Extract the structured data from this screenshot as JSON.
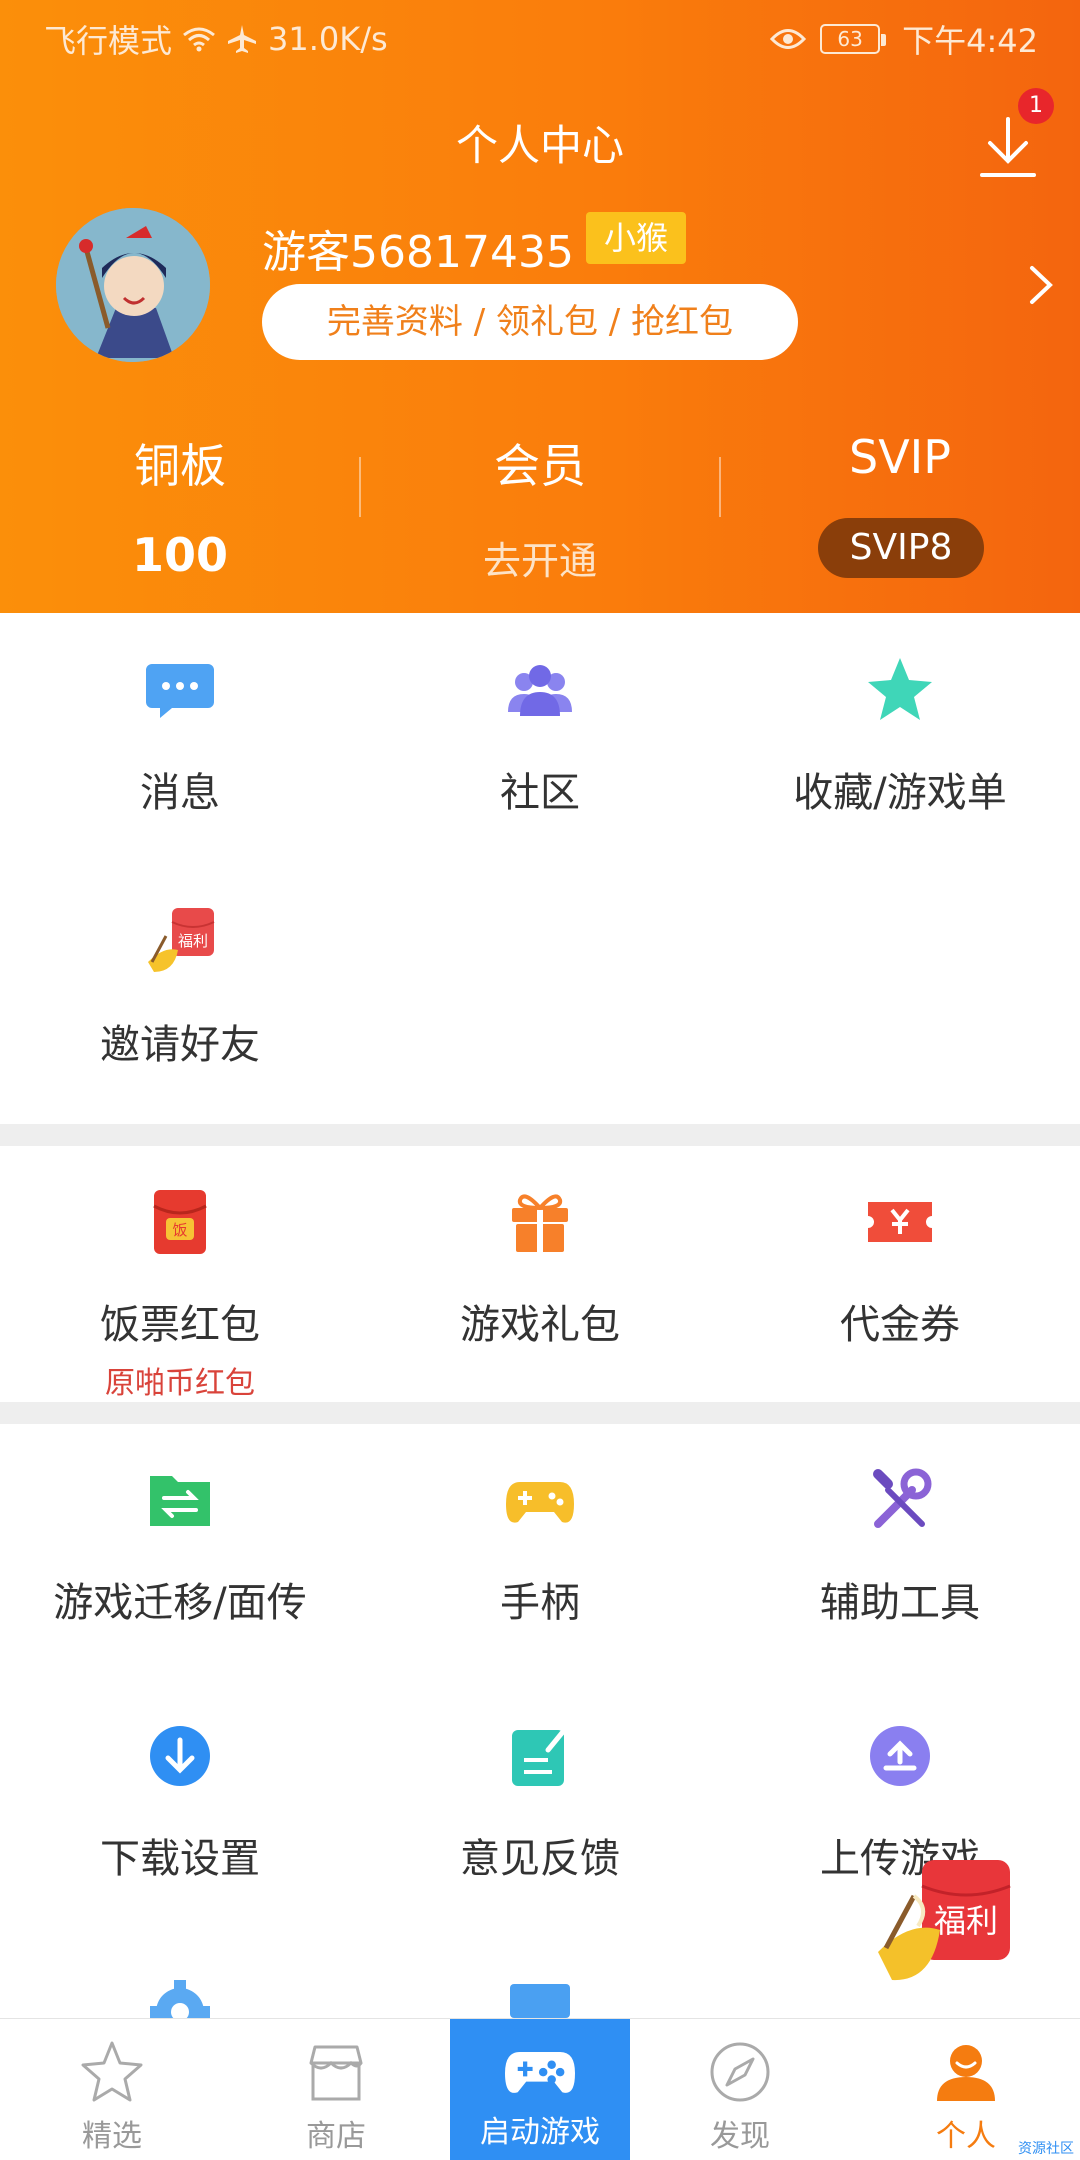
{
  "status_bar": {
    "left_text": "飞行模式",
    "speed": "31.0K/s",
    "battery": "63",
    "time": "下午4:42"
  },
  "header": {
    "title": "个人中心",
    "download_badge": "1"
  },
  "profile": {
    "username": "游客56817435",
    "level_tag": "小猴",
    "action_pill": "完善资料 / 领礼包 / 抢红包"
  },
  "stats": [
    {
      "label": "铜板",
      "value": "100"
    },
    {
      "label": "会员",
      "value": "去开通"
    },
    {
      "label": "SVIP",
      "value": "SVIP8"
    }
  ],
  "grid1": [
    {
      "label": "消息",
      "icon": "message-icon"
    },
    {
      "label": "社区",
      "icon": "community-icon"
    },
    {
      "label": "收藏/游戏单",
      "icon": "star-icon"
    },
    {
      "label": "邀请好友",
      "icon": "invite-fuli-icon"
    }
  ],
  "grid2": [
    {
      "label": "饭票红包",
      "sub": "原啪币红包",
      "icon": "red-envelope-icon"
    },
    {
      "label": "游戏礼包",
      "icon": "gift-icon"
    },
    {
      "label": "代金券",
      "icon": "coupon-icon"
    }
  ],
  "grid3": [
    {
      "label": "游戏迁移/面传",
      "icon": "transfer-folder-icon"
    },
    {
      "label": "手柄",
      "icon": "gamepad-icon"
    },
    {
      "label": "辅助工具",
      "icon": "tools-icon"
    },
    {
      "label": "下载设置",
      "icon": "download-circle-icon"
    },
    {
      "label": "意见反馈",
      "icon": "feedback-icon"
    },
    {
      "label": "上传游戏",
      "icon": "upload-icon"
    }
  ],
  "fuli_label": "福利",
  "fan_label": "饭",
  "tabs": [
    {
      "label": "精选",
      "icon": "star-outline-icon"
    },
    {
      "label": "商店",
      "icon": "shop-icon"
    },
    {
      "label": "启动游戏",
      "icon": "gamepad-icon"
    },
    {
      "label": "发现",
      "icon": "compass-icon"
    },
    {
      "label": "个人",
      "icon": "person-icon"
    }
  ],
  "corner_mark": "资源社区",
  "colors": {
    "orange_start": "#fb8f0a",
    "orange_end": "#f4650e",
    "accent_blue": "#2f8ff3",
    "active_tab": "#f57c10"
  }
}
